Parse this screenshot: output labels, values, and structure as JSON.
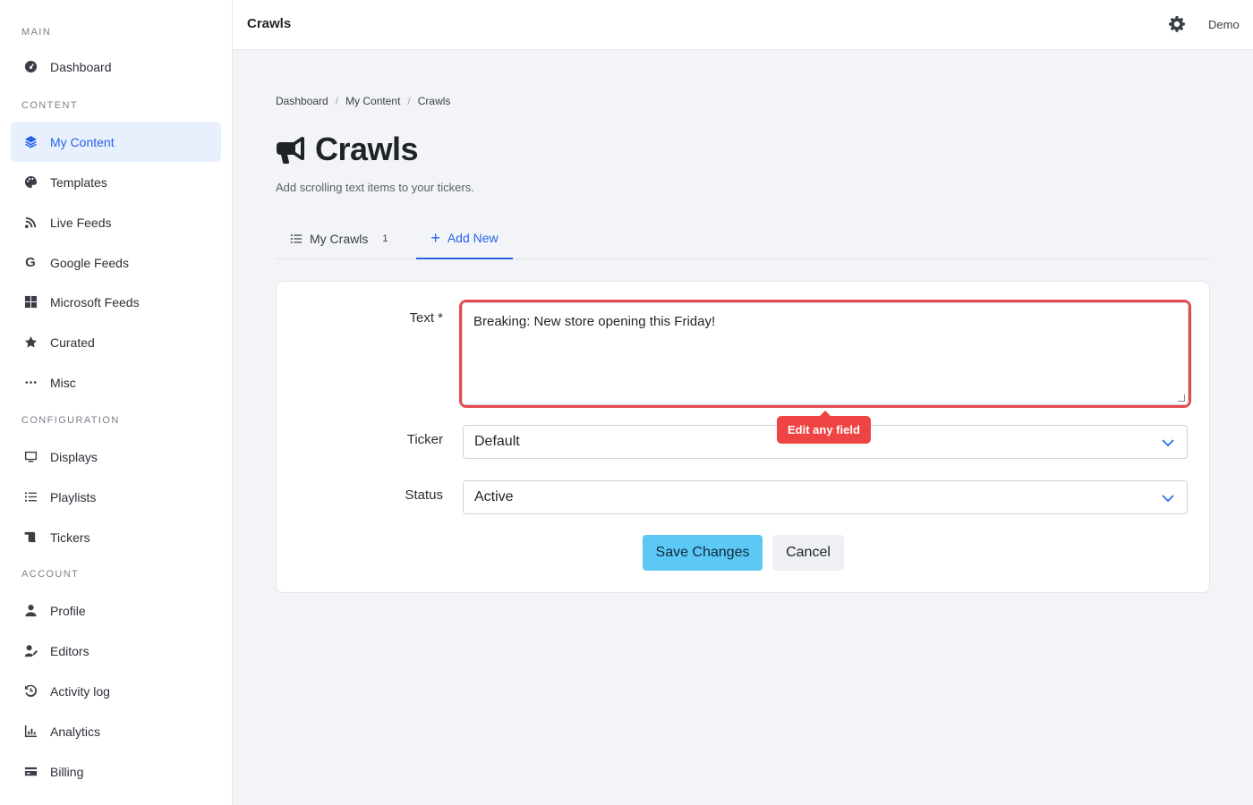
{
  "sidebar": {
    "sections": [
      {
        "label": "MAIN"
      },
      {
        "label": "CONTENT"
      },
      {
        "label": "CONFIGURATION"
      },
      {
        "label": "ACCOUNT"
      }
    ],
    "items": [
      {
        "label": "Dashboard",
        "icon": "dashboard-gauge-icon"
      },
      {
        "label": "My Content",
        "icon": "layers-icon",
        "active": true
      },
      {
        "label": "Templates",
        "icon": "palette-icon"
      },
      {
        "label": "Live Feeds",
        "icon": "satellite-dish-icon"
      },
      {
        "label": "Google Feeds",
        "icon": "google-g-icon"
      },
      {
        "label": "Microsoft Feeds",
        "icon": "windows-logo-icon"
      },
      {
        "label": "Curated",
        "icon": "star-icon"
      },
      {
        "label": "Misc",
        "icon": "ellipsis-icon"
      },
      {
        "label": "Displays",
        "icon": "monitor-icon"
      },
      {
        "label": "Playlists",
        "icon": "list-icon"
      },
      {
        "label": "Tickers",
        "icon": "scroll-icon"
      },
      {
        "label": "Profile",
        "icon": "user-icon"
      },
      {
        "label": "Editors",
        "icon": "user-edit-icon"
      },
      {
        "label": "Activity log",
        "icon": "history-icon"
      },
      {
        "label": "Analytics",
        "icon": "bar-chart-icon"
      },
      {
        "label": "Billing",
        "icon": "credit-card-icon"
      }
    ]
  },
  "topbar": {
    "title": "Crawls",
    "user": "Demo",
    "gear_icon": "gear-icon"
  },
  "breadcrumb": [
    "Dashboard",
    "My Content",
    "Crawls"
  ],
  "page": {
    "title": "Crawls",
    "title_icon": "megaphone-icon",
    "subtitle": "Add scrolling text items to your tickers."
  },
  "tabs": {
    "my_crawls": {
      "label": "My Crawls",
      "count": "1"
    },
    "add_new": {
      "label": "Add New"
    }
  },
  "form": {
    "text_label": "Text *",
    "text_value": "Breaking: New store opening this Friday!",
    "ticker_label": "Ticker",
    "ticker_value": "Default",
    "status_label": "Status",
    "status_value": "Active",
    "tooltip": "Edit any field",
    "save_label": "Save Changes",
    "cancel_label": "Cancel"
  },
  "colors": {
    "accent": "#2563eb",
    "highlight": "#e5484d",
    "save_button": "#5cc8f5"
  }
}
